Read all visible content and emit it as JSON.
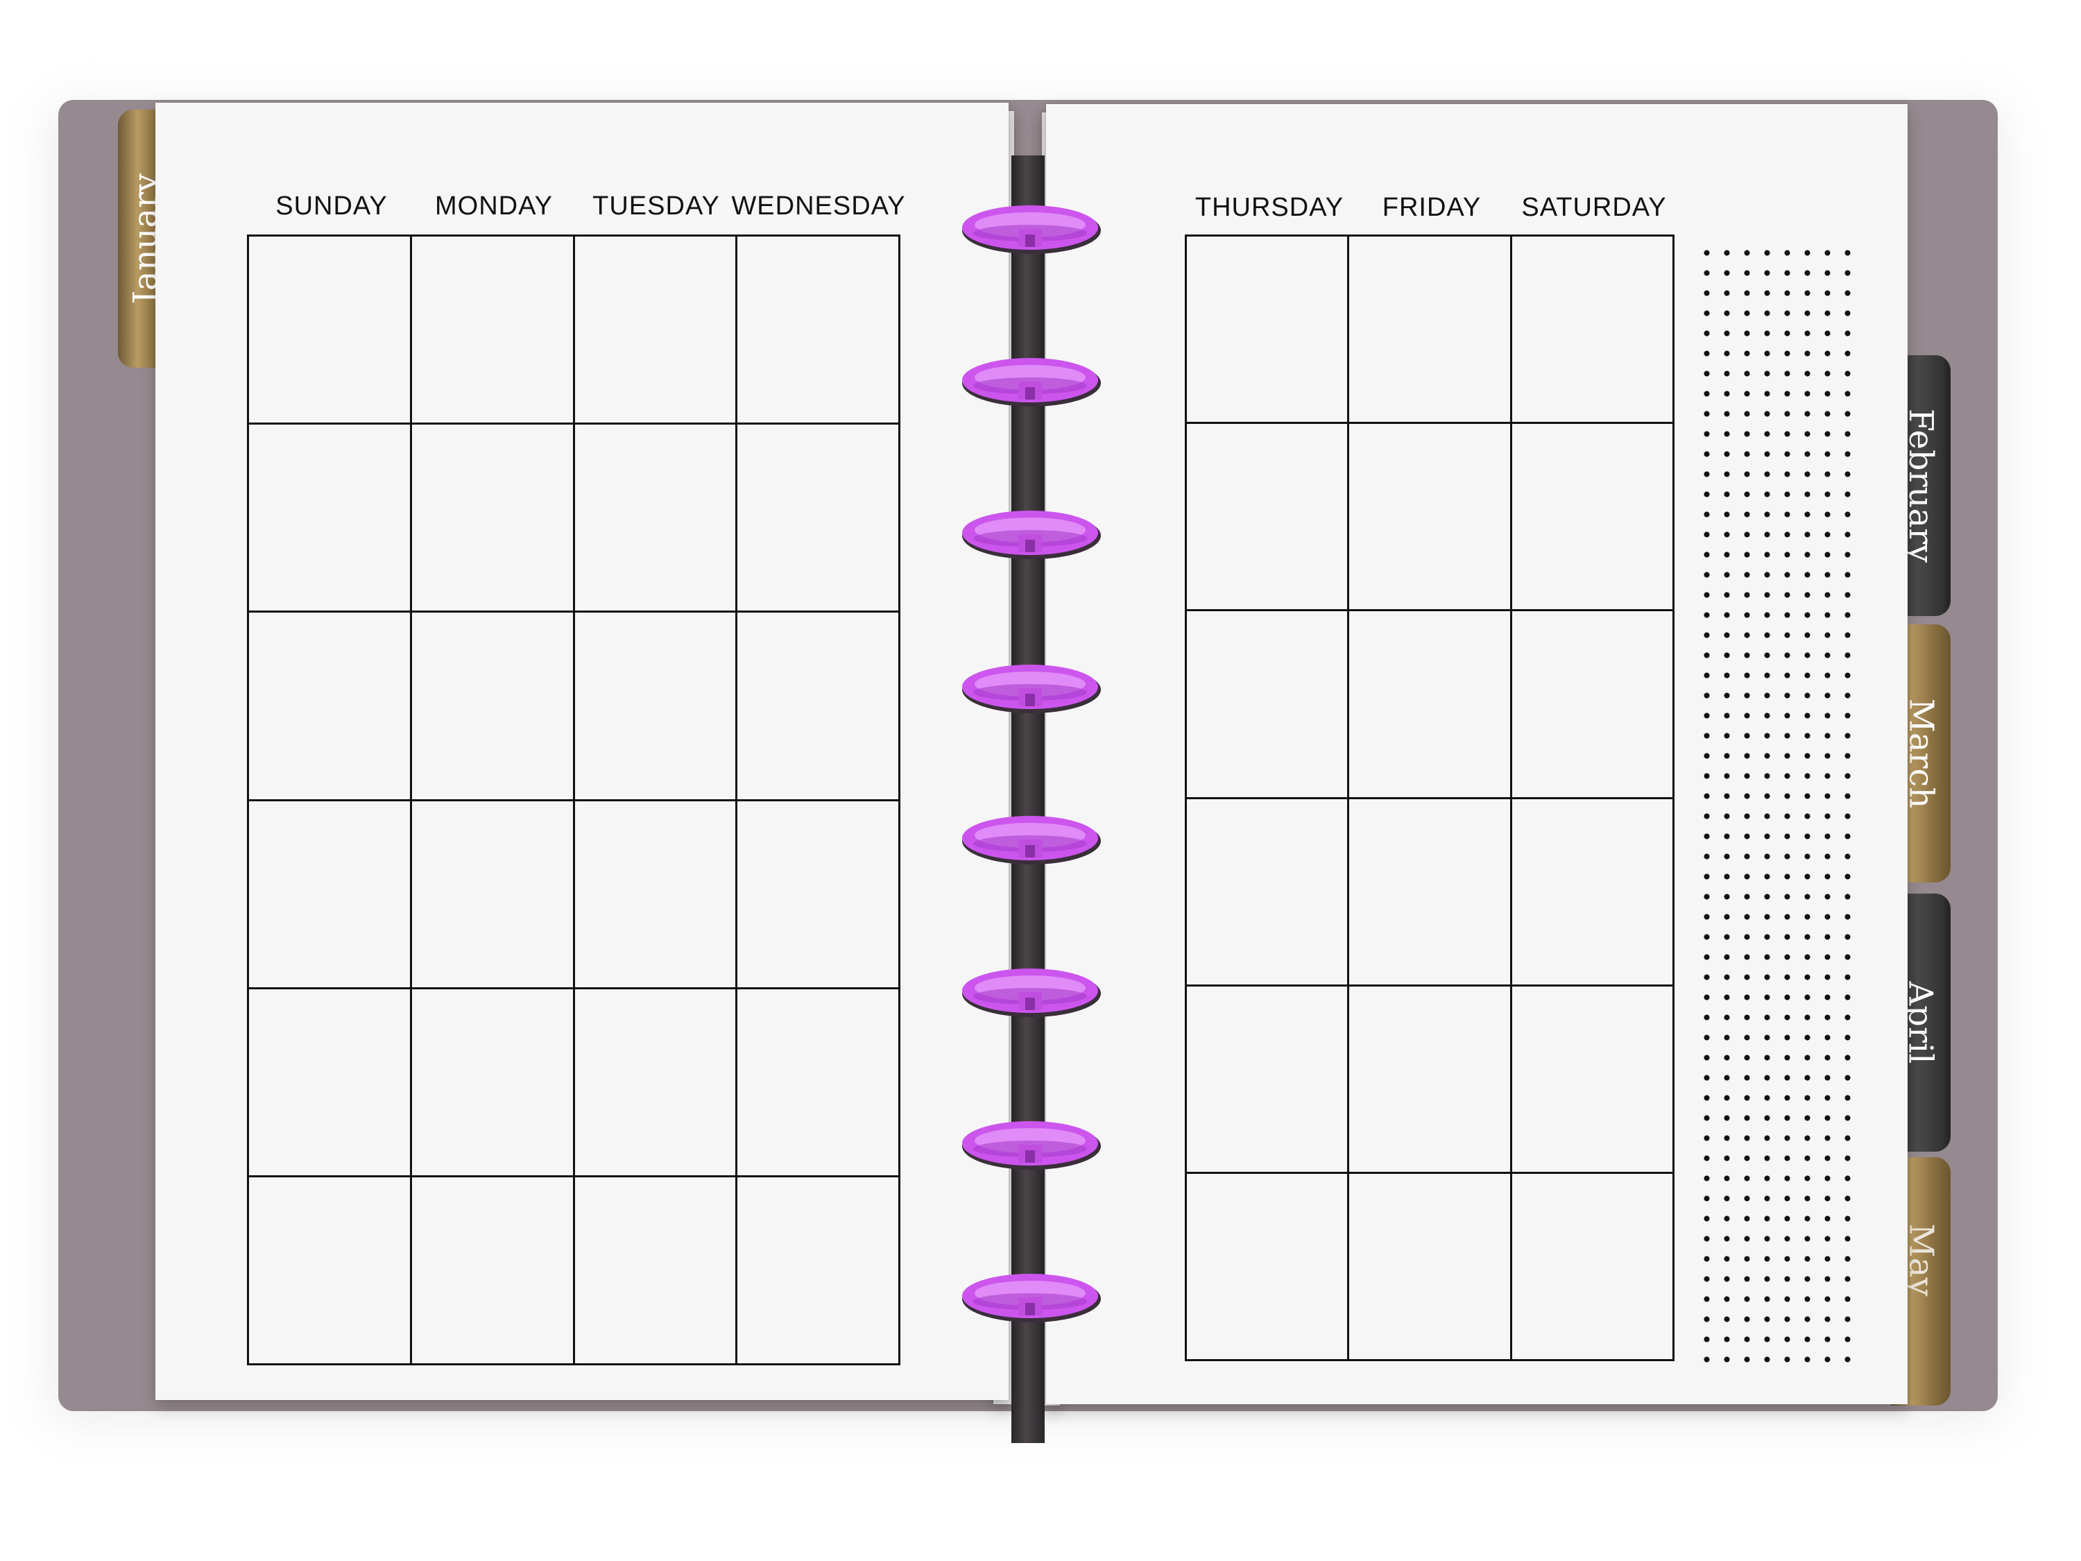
{
  "left_page": {
    "day_labels": [
      "SUNDAY",
      "MONDAY",
      "TUESDAY",
      "WEDNESDAY"
    ],
    "tab": "January"
  },
  "right_page": {
    "day_labels": [
      "THURSDAY",
      "FRIDAY",
      "SATURDAY"
    ]
  },
  "tabs": [
    "January",
    "February",
    "March",
    "April",
    "May"
  ],
  "calendar": {
    "weeks": 6,
    "notes_area": "dot-grid"
  },
  "colors": {
    "cover": "#958a8f",
    "page": "#f6f6f6",
    "rings": "#cc55ee",
    "tab_gold": "#b99b63",
    "tab_dark": "#333333"
  }
}
